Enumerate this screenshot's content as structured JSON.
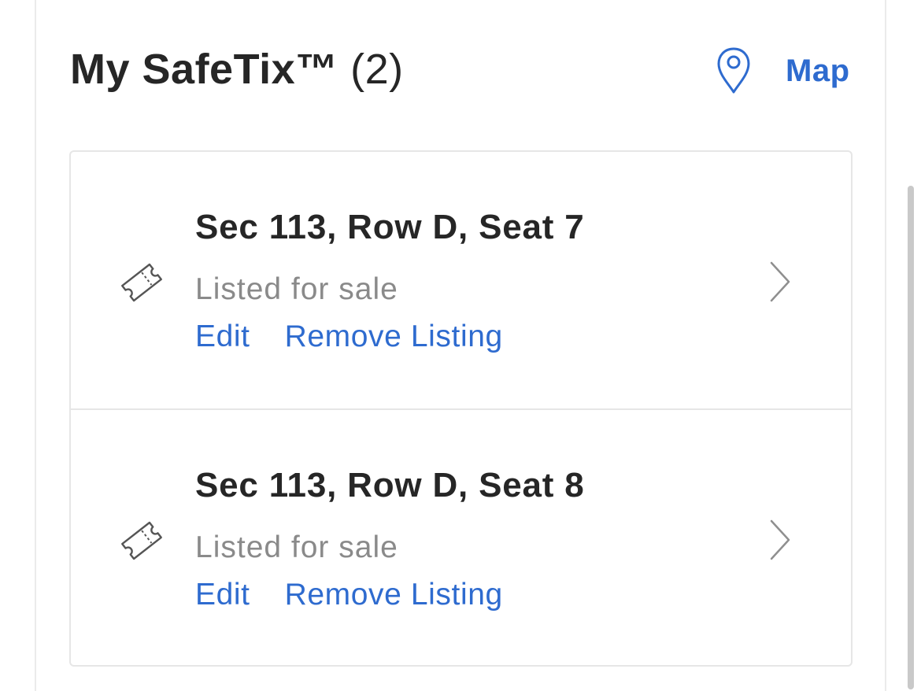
{
  "header": {
    "title": "My SafeTix™",
    "count": "(2)",
    "map_label": "Map",
    "map_icon": "location-pin-icon"
  },
  "tickets": [
    {
      "seat": "Sec 113, Row D, Seat 7",
      "status": "Listed for sale",
      "edit_label": "Edit",
      "remove_label": "Remove Listing",
      "icon": "ticket-icon"
    },
    {
      "seat": "Sec 113, Row D, Seat 8",
      "status": "Listed for sale",
      "edit_label": "Edit",
      "remove_label": "Remove Listing",
      "icon": "ticket-icon"
    }
  ],
  "colors": {
    "accent": "#2e6bcf",
    "text": "#262626",
    "muted": "#8a8a8a",
    "border": "#e6e6e6"
  }
}
